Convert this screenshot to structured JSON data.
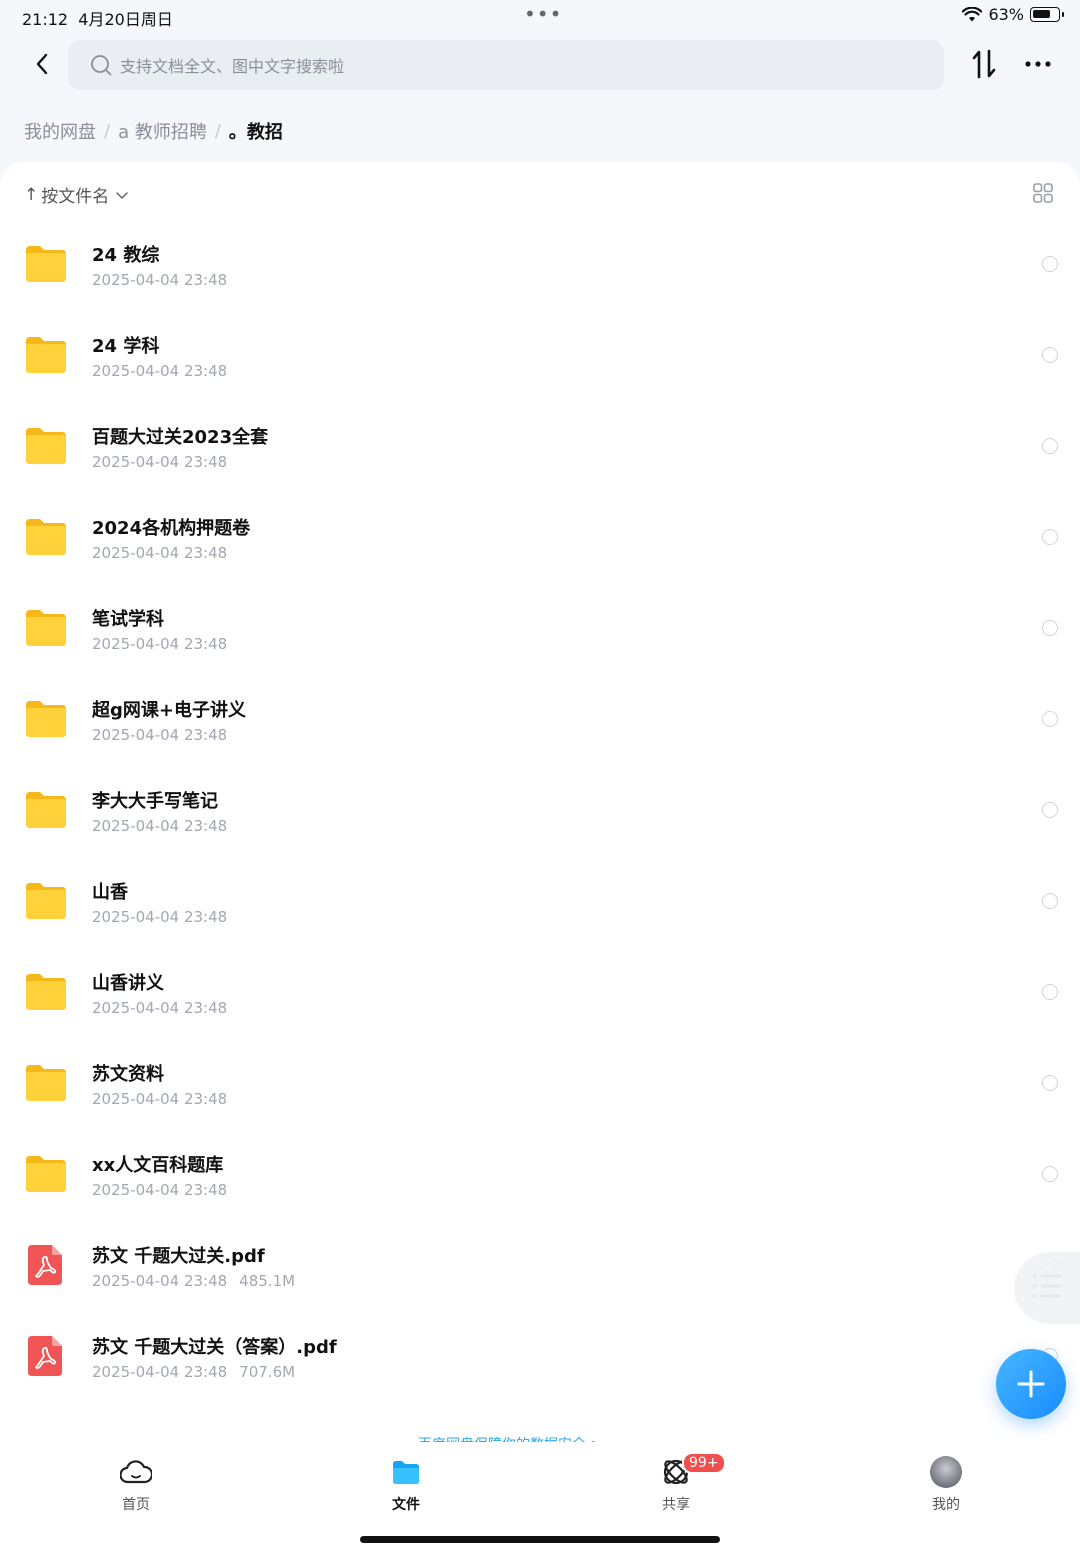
{
  "status_bar": {
    "time": "21:12",
    "date": "4月20日周日",
    "battery": "63%"
  },
  "header": {
    "search_placeholder": "支持文档全文、图中文字搜索啦"
  },
  "breadcrumb": {
    "items": [
      "我的网盘",
      "a 教师招聘"
    ],
    "current": "。教招"
  },
  "sort": {
    "label": "按文件名"
  },
  "files": [
    {
      "name": "24 教综",
      "date": "2025-04-04 23:48",
      "size": "",
      "type": "folder"
    },
    {
      "name": "24 学科",
      "date": "2025-04-04 23:48",
      "size": "",
      "type": "folder"
    },
    {
      "name": "百题大过关2023全套",
      "date": "2025-04-04 23:48",
      "size": "",
      "type": "folder"
    },
    {
      "name": "2024各机构押题卷",
      "date": "2025-04-04 23:48",
      "size": "",
      "type": "folder"
    },
    {
      "name": "笔试学科",
      "date": "2025-04-04 23:48",
      "size": "",
      "type": "folder"
    },
    {
      "name": "超g网课+电子讲义",
      "date": "2025-04-04 23:48",
      "size": "",
      "type": "folder"
    },
    {
      "name": "李大大手写笔记",
      "date": "2025-04-04 23:48",
      "size": "",
      "type": "folder"
    },
    {
      "name": "山香",
      "date": "2025-04-04 23:48",
      "size": "",
      "type": "folder"
    },
    {
      "name": "山香讲义",
      "date": "2025-04-04 23:48",
      "size": "",
      "type": "folder"
    },
    {
      "name": "苏文资料",
      "date": "2025-04-04 23:48",
      "size": "",
      "type": "folder"
    },
    {
      "name": "xx人文百科题库",
      "date": "2025-04-04 23:48",
      "size": "",
      "type": "folder"
    },
    {
      "name": "苏文 千题大过关.pdf",
      "date": "2025-04-04 23:48",
      "size": "485.1M",
      "type": "pdf"
    },
    {
      "name": "苏文 千题大过关（答案）.pdf",
      "date": "2025-04-04 23:48",
      "size": "707.6M",
      "type": "pdf"
    }
  ],
  "banner": {
    "text": "百度网盘保障你的数据安全 >"
  },
  "bottom_nav": {
    "home": "首页",
    "files": "文件",
    "share": "共享",
    "share_badge": "99+",
    "me": "我的"
  },
  "colors": {
    "accent": "#1a8cff",
    "folder": "#ffc928",
    "pdf": "#f05454",
    "badge": "#f24e4e"
  }
}
